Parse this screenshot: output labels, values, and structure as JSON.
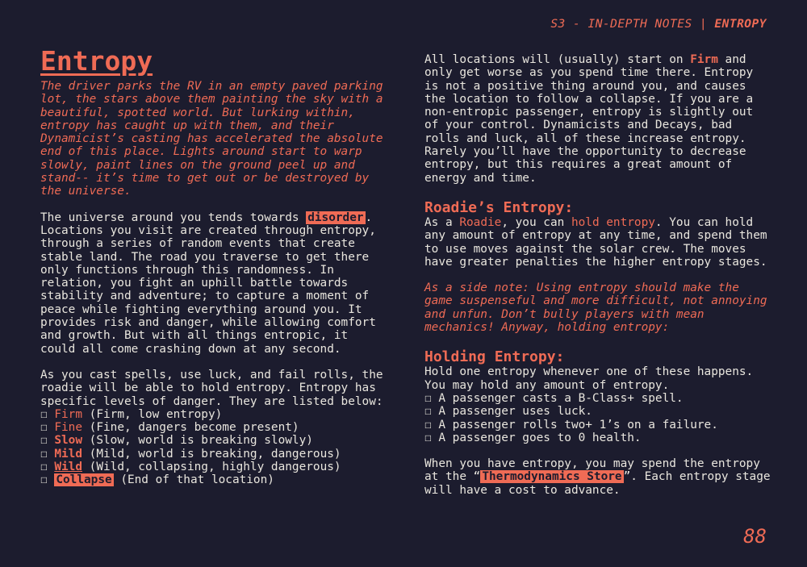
{
  "header": {
    "section": "S3 - IN-DEPTH NOTES | ",
    "topic": "ENTROPY"
  },
  "page_number": "88",
  "left": {
    "title": "Entropy",
    "flavor": "The driver parks the RV in an empty paved parking lot, the stars above them painting the sky with a beautiful, spotted world. But lurking within, entropy has caught up with them, and their Dynamicist’s casting has accelerated the absolute end of this place. Lights around start to warp slowly, paint lines on the ground peel up and stand-- it’s time to get out or be destroyed by the universe.",
    "p1_pre": "The universe around you tends towards ",
    "p1_hl": "disorder",
    "p1_post": ". Locations you visit are created through entropy, through a series of random events that create stable land. The road you traverse to get there only functions through this randomness. In relation, you fight an uphill battle towards stability and adventure; to capture a moment of peace while fighting everything around you. It provides risk and danger, while allowing comfort and growth. But with all things entropic, it could all come crashing down at any second.",
    "p2": "As you cast spells, use luck, and fail rolls, the roadie will be able to hold entropy. Entropy has specific levels of danger. They are listed below:",
    "levels": [
      {
        "box": "☐",
        "name": "Firm",
        "desc": " (Firm, low entropy)"
      },
      {
        "box": "☐",
        "name": "Fine",
        "desc": " (Fine, dangers become present)"
      },
      {
        "box": "☐",
        "name": "Slow",
        "desc": " (Slow, world is breaking slowly)"
      },
      {
        "box": "☐",
        "name": "Mild",
        "desc": " (Mild, world is breaking, dangerous)"
      },
      {
        "box": "☐",
        "name": "Wild",
        "desc": " (Wild, collapsing, highly dangerous)"
      },
      {
        "box": "☐",
        "name": "Collapse",
        "desc": " (End of that location)"
      }
    ]
  },
  "right": {
    "p1_pre": "All locations will (usually) start on ",
    "p1_firm": "Firm",
    "p1_post": " and only get worse as you spend time there. Entropy is not a positive thing around you, and causes the location to follow a collapse. If you are a non-entropic passenger, entropy is slightly out of your control. Dynamicists and Decays, bad rolls and luck, all of these increase entropy. Rarely you’ll have the opportunity to decrease entropy, but this requires a great amount of energy and time.",
    "h_roadie": "Roadie’s Entropy:",
    "roadie_pre": "As a ",
    "roadie_word": "Roadie",
    "roadie_mid": ", you can ",
    "roadie_hold": "hold entropy",
    "roadie_post": ". You can hold any amount of entropy at any time, and spend them to use moves against the solar crew. The moves have greater penalties the higher entropy stages.",
    "side_note": "As a side note: Using entropy should make the game suspenseful and more difficult, not annoying and unfun. Don’t bully players with mean mechanics! Anyway, holding entropy:",
    "h_holding": "Holding Entropy:",
    "holding_text": "Hold one entropy whenever one of these happens. You may hold any amount of entropy.",
    "triggers": [
      "☐ A passenger casts a B-Class+ spell.",
      "☐ A passenger uses luck.",
      "☐ A passenger rolls two+ 1’s on a failure.",
      "☐ A passenger goes to 0 health."
    ],
    "spend_pre": "When you have entropy, you may spend the entropy at the “",
    "spend_hl": "Thermodynamics Store",
    "spend_post": "”. Each entropy stage will have a cost to advance."
  }
}
